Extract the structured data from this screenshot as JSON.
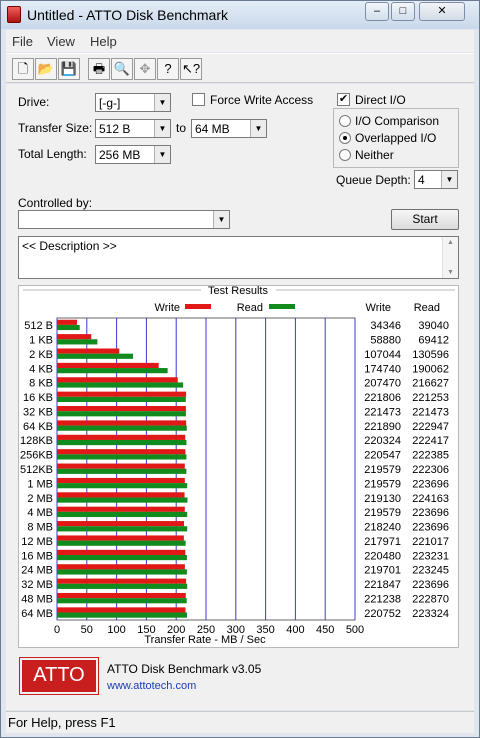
{
  "window": {
    "title": "Untitled - ATTO Disk Benchmark",
    "min_label": "–",
    "max_label": "□",
    "close_label": "✕"
  },
  "menu": {
    "items": [
      "File",
      "View",
      "Help"
    ]
  },
  "toolbar": {
    "icons": [
      "new-icon",
      "open-icon",
      "save-icon",
      "print-icon",
      "print-preview-icon",
      "move-icon",
      "help-icon",
      "context-help-icon"
    ]
  },
  "form": {
    "drive_label": "Drive:",
    "drive_value": "[-g-]",
    "transfer_size_label": "Transfer Size:",
    "transfer_from": "512 B",
    "to_label": "to",
    "transfer_to": "64 MB",
    "total_length_label": "Total Length:",
    "total_length_value": "256 MB",
    "force_write_label": "Force Write Access",
    "force_write_checked": false,
    "direct_io_label": "Direct I/O",
    "direct_io_checked": true,
    "io_comparison_label": "I/O Comparison",
    "overlapped_io_label": "Overlapped I/O",
    "neither_label": "Neither",
    "queue_depth_label": "Queue Depth:",
    "queue_depth_value": "4",
    "controlled_by_label": "Controlled by:",
    "controlled_by_value": "",
    "start_label": "Start",
    "description": "<< Description >>"
  },
  "results": {
    "heading": "Test Results",
    "write_legend": "Write",
    "read_legend": "Read",
    "write_col": "Write",
    "read_col": "Read",
    "write_color": "#e01818",
    "read_color": "#118a1e"
  },
  "chart_data": {
    "type": "bar",
    "orientation": "horizontal",
    "title": "Test Results",
    "xlabel": "Transfer Rate - MB / Sec",
    "xlim": [
      0,
      500
    ],
    "xticks": [
      "0",
      "50",
      "100",
      "150",
      "200",
      "250",
      "300",
      "350",
      "400",
      "450",
      "500"
    ],
    "grid": true,
    "legend": "top",
    "categories": [
      "512 B",
      "1 KB",
      "2 KB",
      "4 KB",
      "8 KB",
      "16 KB",
      "32 KB",
      "64 KB",
      "128KB",
      "256KB",
      "512KB",
      "1 MB",
      "2 MB",
      "4 MB",
      "8 MB",
      "12 MB",
      "16 MB",
      "24 MB",
      "32 MB",
      "48 MB",
      "64 MB"
    ],
    "series": [
      {
        "name": "Write",
        "color": "#e01818",
        "values": [
          34346,
          58880,
          107044,
          174740,
          207470,
          221806,
          221473,
          221890,
          220324,
          220547,
          219579,
          219579,
          219130,
          219579,
          218240,
          217971,
          220480,
          219701,
          221847,
          221238,
          220752
        ]
      },
      {
        "name": "Read",
        "color": "#118a1e",
        "values": [
          39040,
          69412,
          130596,
          190062,
          216627,
          221253,
          221473,
          222947,
          222417,
          222385,
          222306,
          223696,
          224163,
          223696,
          223696,
          221017,
          223231,
          223245,
          223696,
          222870,
          223324
        ]
      }
    ]
  },
  "footer": {
    "logo_text": "ATTO",
    "product": "ATTO Disk Benchmark v3.05",
    "url": "www.attotech.com"
  },
  "status": {
    "text": "For Help, press F1"
  }
}
